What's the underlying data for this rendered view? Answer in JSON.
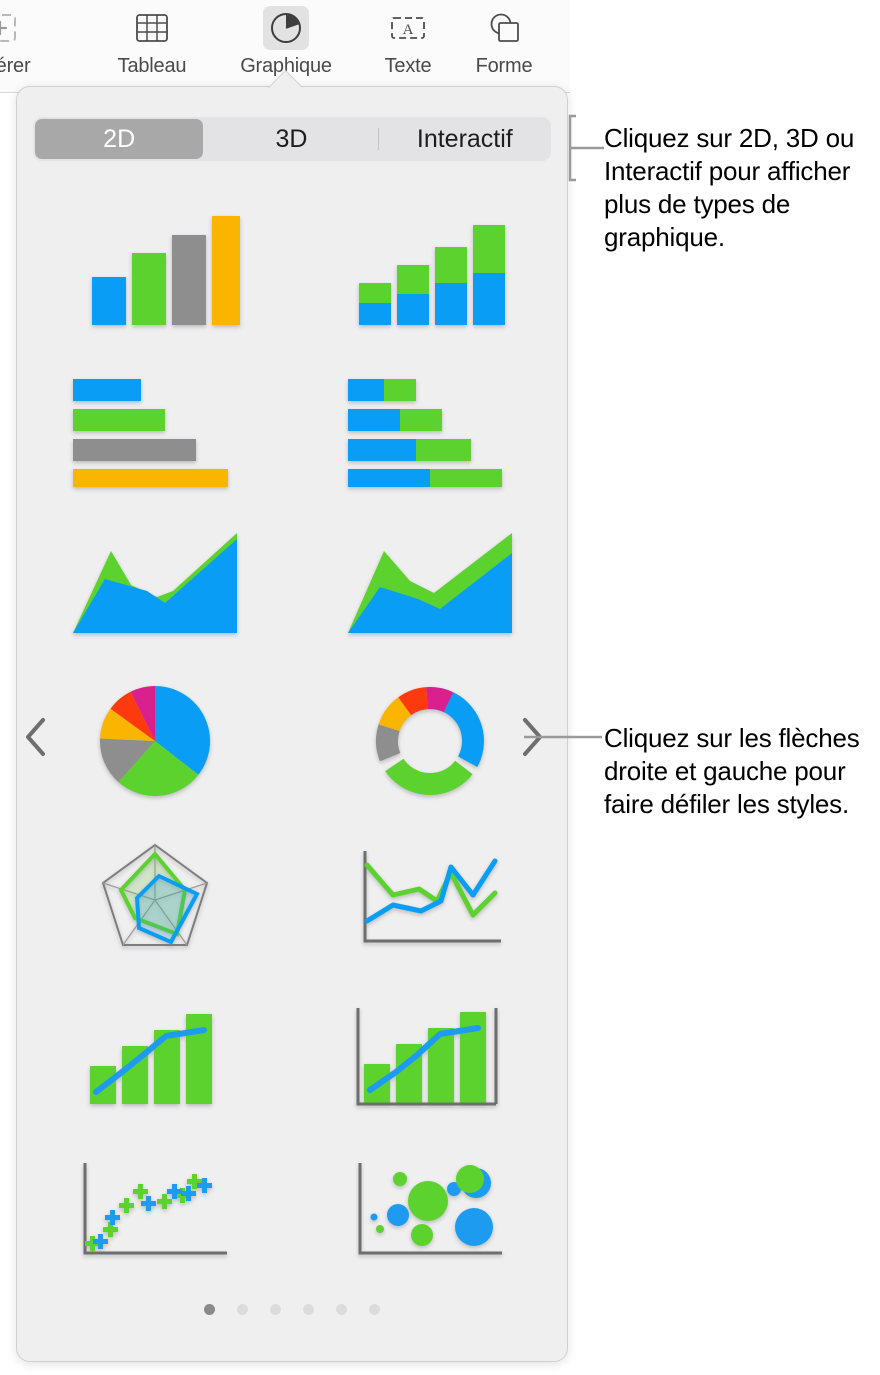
{
  "toolbar": {
    "items": [
      {
        "label": "Insérer",
        "icon": "insert-icon",
        "active": false
      },
      {
        "label": "Tableau",
        "icon": "table-icon",
        "active": false
      },
      {
        "label": "Graphique",
        "icon": "chart-icon",
        "active": true
      },
      {
        "label": "Texte",
        "icon": "text-icon",
        "active": false
      },
      {
        "label": "Forme",
        "icon": "shape-icon",
        "active": false
      }
    ]
  },
  "popover": {
    "tabs": [
      {
        "label": "2D",
        "active": true
      },
      {
        "label": "3D",
        "active": false
      },
      {
        "label": "Interactif",
        "active": false
      }
    ],
    "nav": {
      "prev_icon": "chevron-left-icon",
      "next_icon": "chevron-right-icon"
    },
    "pager": {
      "total": 6,
      "current": 1
    },
    "chart_types": [
      {
        "name": "column-chart",
        "row": 1,
        "col": 1
      },
      {
        "name": "stacked-column-chart",
        "row": 1,
        "col": 2
      },
      {
        "name": "bar-chart",
        "row": 2,
        "col": 1
      },
      {
        "name": "stacked-bar-chart",
        "row": 2,
        "col": 2
      },
      {
        "name": "area-chart",
        "row": 3,
        "col": 1
      },
      {
        "name": "stacked-area-chart",
        "row": 3,
        "col": 2
      },
      {
        "name": "pie-chart",
        "row": 4,
        "col": 1
      },
      {
        "name": "donut-chart",
        "row": 4,
        "col": 2
      },
      {
        "name": "radar-chart",
        "row": 5,
        "col": 1
      },
      {
        "name": "line-chart",
        "row": 5,
        "col": 2
      },
      {
        "name": "mixed-chart",
        "row": 6,
        "col": 1
      },
      {
        "name": "two-axis-chart",
        "row": 6,
        "col": 2
      },
      {
        "name": "scatter-chart",
        "row": 7,
        "col": 1
      },
      {
        "name": "bubble-chart",
        "row": 7,
        "col": 2
      }
    ]
  },
  "callouts": {
    "first": "Cliquez sur 2D, 3D ou Interactif pour afficher plus de types de graphique.",
    "second": "Cliquez sur les flèches droite et gauche pour faire défiler les styles."
  },
  "colors": {
    "blue": "#0a9df5",
    "green": "#5cd22e",
    "gray": "#8e8e8e",
    "orange": "#fab500",
    "red": "#fc3a0e",
    "magenta": "#d9208c",
    "popover_bg": "#efeff0",
    "segment_bg": "#e3e3e5",
    "segment_active": "#a8a8a8"
  }
}
